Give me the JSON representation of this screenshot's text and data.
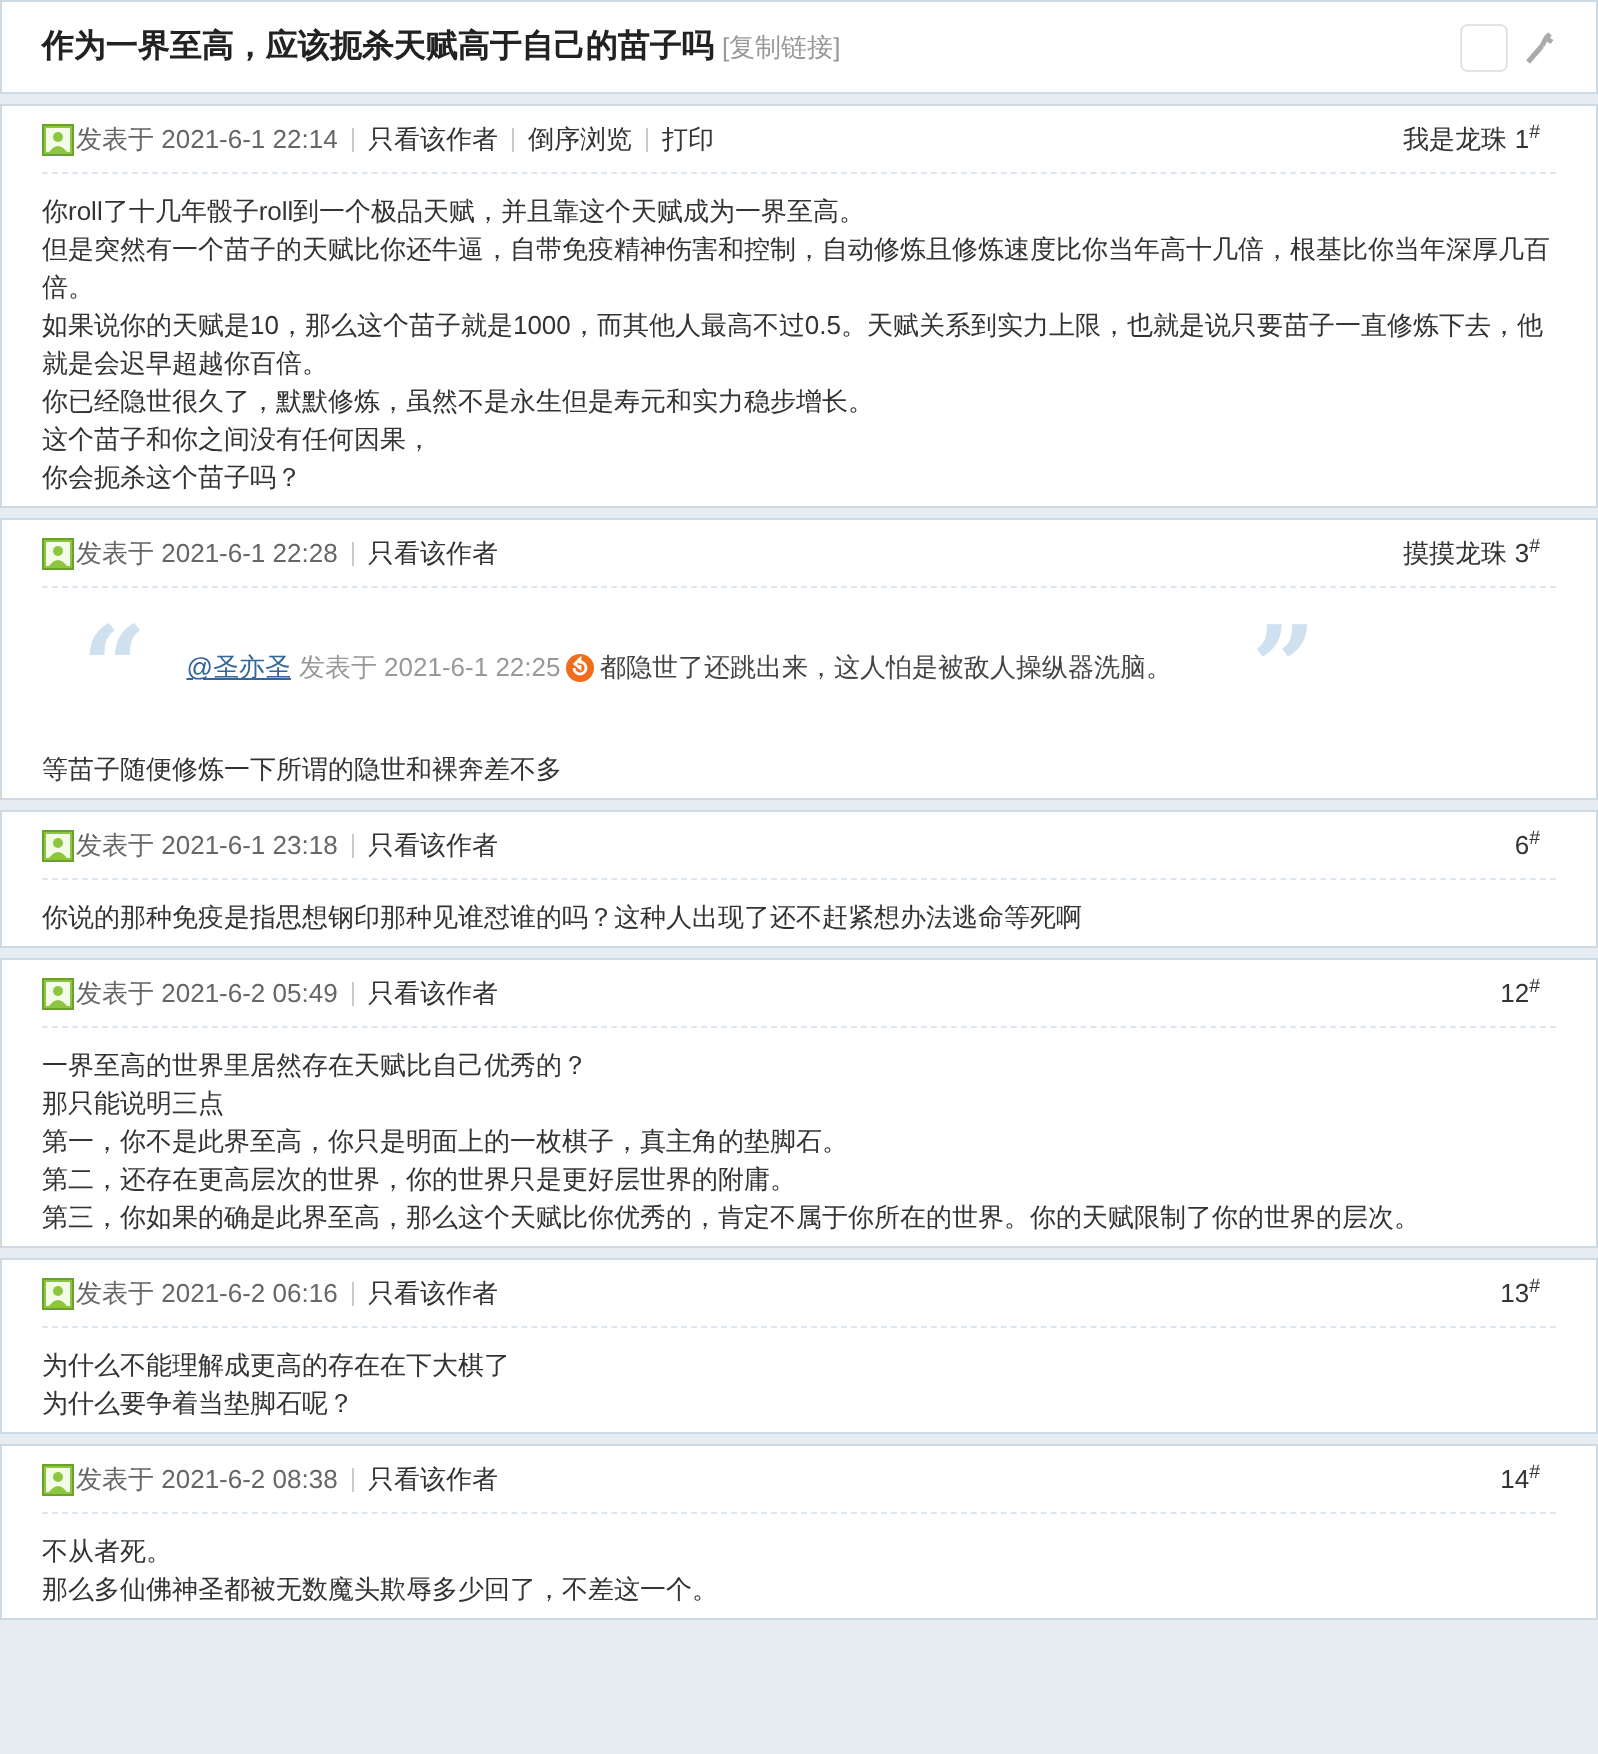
{
  "title": {
    "text": "作为一界至高，应该扼杀天赋高于自己的苗子吗",
    "link": "[复制链接]"
  },
  "posts": [
    {
      "posted": "发表于",
      "time": "2021-6-1 22:14",
      "links": [
        "只看该作者",
        "倒序浏览",
        "打印"
      ],
      "author": "我是龙珠",
      "floor": "1",
      "floor_mark": "#",
      "lines": [
        "你roll了十几年骰子roll到一个极品天赋，并且靠这个天赋成为一界至高。",
        "但是突然有一个苗子的天赋比你还牛逼，自带免疫精神伤害和控制，自动修炼且修炼速度比你当年高十几倍，根基比你当年深厚几百倍。",
        "如果说你的天赋是10，那么这个苗子就是1000，而其他人最高不过0.5。天赋关系到实力上限，也就是说只要苗子一直修炼下去，他就是会迟早超越你百倍。",
        "你已经隐世很久了，默默修炼，虽然不是永生但是寿元和实力稳步增长。",
        "这个苗子和你之间没有任何因果，",
        "你会扼杀这个苗子吗？"
      ]
    },
    {
      "posted": "发表于",
      "time": "2021-6-1 22:28",
      "links": [
        "只看该作者"
      ],
      "author": "摸摸龙珠",
      "floor": "3",
      "floor_mark": "#",
      "quote": {
        "open": "“",
        "close": "”",
        "user": "@圣亦圣",
        "posted": "发表于",
        "time": "2021-6-1 22:25",
        "text": "都隐世了还跳出来，这人怕是被敌人操纵器洗脑。"
      },
      "lines": [
        "等苗子随便修炼一下所谓的隐世和裸奔差不多"
      ]
    },
    {
      "posted": "发表于",
      "time": "2021-6-1 23:18",
      "links": [
        "只看该作者"
      ],
      "floor": "6",
      "floor_mark": "#",
      "lines": [
        "你说的那种免疫是指思想钢印那种见谁怼谁的吗？这种人出现了还不赶紧想办法逃命等死啊"
      ]
    },
    {
      "posted": "发表于",
      "time": "2021-6-2 05:49",
      "links": [
        "只看该作者"
      ],
      "floor": "12",
      "floor_mark": "#",
      "lines": [
        "一界至高的世界里居然存在天赋比自己优秀的？",
        "那只能说明三点",
        "第一，你不是此界至高，你只是明面上的一枚棋子，真主角的垫脚石。",
        "第二，还存在更高层次的世界，你的世界只是更好层世界的附庸。",
        "第三，你如果的确是此界至高，那么这个天赋比你优秀的，肯定不属于你所在的世界。你的天赋限制了你的世界的层次。"
      ]
    },
    {
      "posted": "发表于",
      "time": "2021-6-2 06:16",
      "links": [
        "只看该作者"
      ],
      "floor": "13",
      "floor_mark": "#",
      "lines": [
        "为什么不能理解成更高的存在在下大棋了",
        "为什么要争着当垫脚石呢？"
      ]
    },
    {
      "posted": "发表于",
      "time": "2021-6-2 08:38",
      "links": [
        "只看该作者"
      ],
      "floor": "14",
      "floor_mark": "#",
      "lines": [
        "不从者死。",
        "那么多仙佛神圣都被无数魔头欺辱多少回了，不差这一个。"
      ]
    }
  ]
}
